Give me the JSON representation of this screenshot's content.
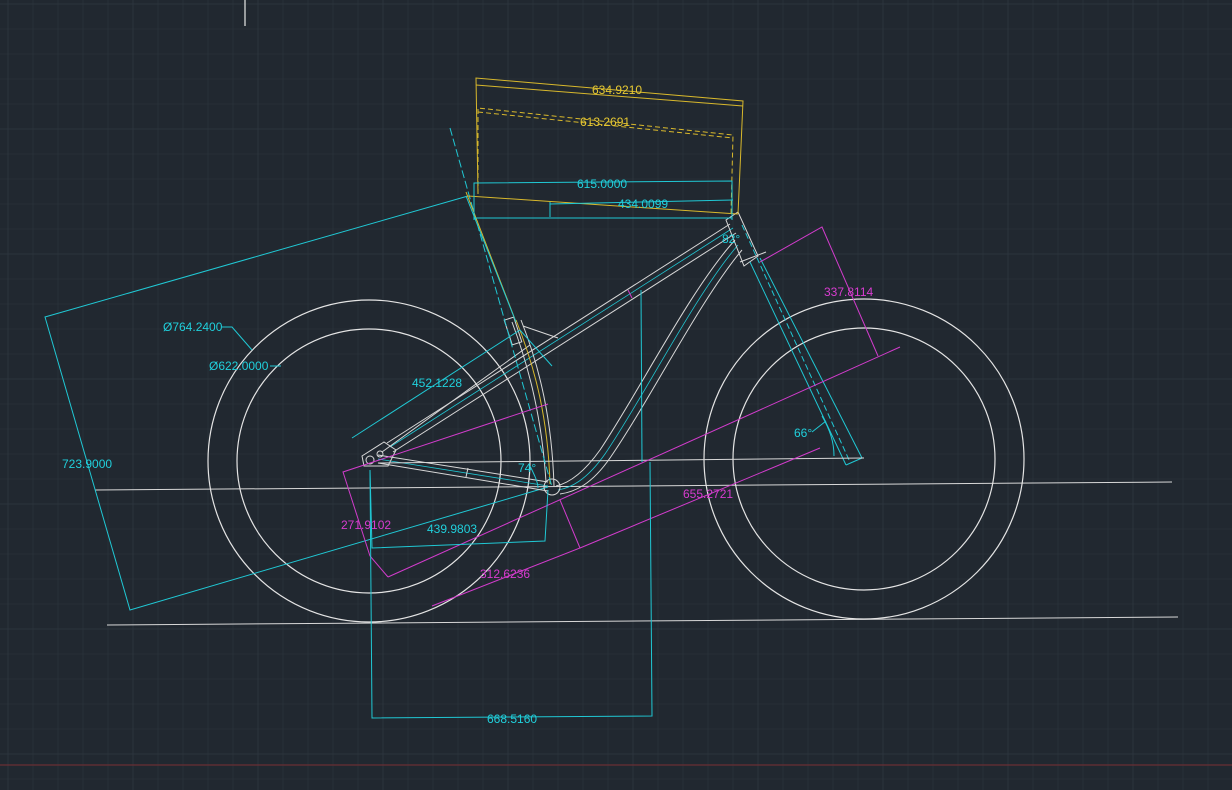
{
  "drawing": {
    "background": "#212830",
    "colors": {
      "cyan": "#20c8d4",
      "yellow": "#d8b82c",
      "magenta": "#d23ccc",
      "white": "#e4e4e4",
      "grid": "#2c343d",
      "axis_red": "#7a2f33"
    }
  },
  "dimensions": {
    "yellow_top": "634.9210",
    "yellow_dashed": "613.2691",
    "cyan_615": "615.0000",
    "cyan_434": "434.0099",
    "angle_head_top": "82°",
    "mag_fork": "337.8114",
    "dia_outer": "Ø764.2400",
    "dia_inner": "Ø622.0000",
    "cyan_452": "452.1228",
    "cyan_723": "723.9000",
    "angle_seat": "74°",
    "angle_head": "66°",
    "mag_655": "655.2721",
    "mag_271": "271.9102",
    "cyan_439": "439.9803",
    "mag_312": "312.6236",
    "cyan_668": "668.5160"
  }
}
